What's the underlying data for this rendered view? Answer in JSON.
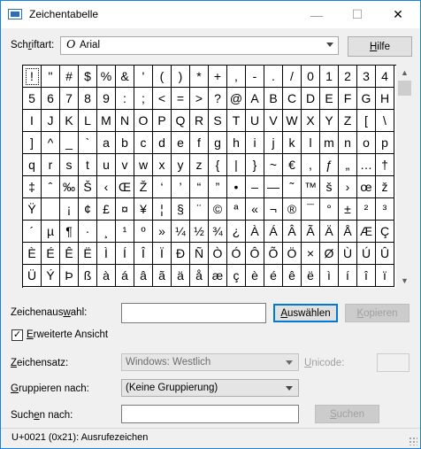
{
  "window": {
    "title": "Zeichentabelle",
    "minimize_glyph": "—",
    "maximize_glyph": "☐",
    "close_glyph": "✕"
  },
  "font_row": {
    "label_pre": "Sch",
    "label_acc": "r",
    "label_post": "iftart:",
    "font_icon": "O",
    "font_value": "Arial",
    "help_pre": "",
    "help_acc": "H",
    "help_post": "ilfe"
  },
  "grid": {
    "columns": 20,
    "selected_index": 0,
    "chars": [
      "!",
      "\"",
      "#",
      "$",
      "%",
      "&",
      "'",
      "(",
      ")",
      "*",
      "+",
      ",",
      "-",
      ".",
      "/",
      "0",
      "1",
      "2",
      "3",
      "4",
      "5",
      "6",
      "7",
      "8",
      "9",
      ":",
      ";",
      "<",
      "=",
      ">",
      "?",
      "@",
      "A",
      "B",
      "C",
      "D",
      "E",
      "F",
      "G",
      "H",
      "I",
      "J",
      "K",
      "L",
      "M",
      "N",
      "O",
      "P",
      "Q",
      "R",
      "S",
      "T",
      "U",
      "V",
      "W",
      "X",
      "Y",
      "Z",
      "[",
      "\\",
      "]",
      "^",
      "_",
      "`",
      "a",
      "b",
      "c",
      "d",
      "e",
      "f",
      "g",
      "h",
      "i",
      "j",
      "k",
      "l",
      "m",
      "n",
      "o",
      "p",
      "q",
      "r",
      "s",
      "t",
      "u",
      "v",
      "w",
      "x",
      "y",
      "z",
      "{",
      "|",
      "}",
      "~",
      "€",
      ",",
      "ƒ",
      "„",
      "…",
      "†",
      "‡",
      "ˆ",
      "‰",
      "Š",
      "‹",
      "Œ",
      "Ž",
      "‘",
      "’",
      "“",
      "”",
      "•",
      "–",
      "—",
      "˜",
      "™",
      "š",
      "›",
      "œ",
      "ž",
      "Ÿ",
      " ",
      "¡",
      "¢",
      "£",
      "¤",
      "¥",
      "¦",
      "§",
      "¨",
      "©",
      "ª",
      "«",
      "¬",
      "®",
      "¯",
      "°",
      "±",
      "²",
      "³",
      "´",
      "µ",
      "¶",
      "·",
      "¸",
      "¹",
      "º",
      "»",
      "¼",
      "½",
      "¾",
      "¿",
      "À",
      "Á",
      "Â",
      "Ã",
      "Ä",
      "Å",
      "Æ",
      "Ç",
      "È",
      "É",
      "Ê",
      "Ë",
      "Ì",
      "Í",
      "Î",
      "Ï",
      "Ð",
      "Ñ",
      "Ò",
      "Ó",
      "Ô",
      "Õ",
      "Ö",
      "×",
      "Ø",
      "Ù",
      "Ú",
      "Û",
      "Ü",
      "Ý",
      "Þ",
      "ß",
      "à",
      "á",
      "â",
      "ã",
      "ä",
      "å",
      "æ",
      "ç",
      "è",
      "é",
      "ê",
      "ë",
      "ì",
      "í",
      "î",
      "ï"
    ]
  },
  "scrollbar": {
    "up_glyph": "▲",
    "down_glyph": "▼"
  },
  "selection_row": {
    "label_pre": "Zeichenaus",
    "label_acc": "w",
    "label_post": "ahl:",
    "value": "",
    "select_pre": "",
    "select_acc": "A",
    "select_post": "uswählen",
    "copy_pre": "",
    "copy_acc": "K",
    "copy_post": "opieren"
  },
  "advanced": {
    "checked_glyph": "✓",
    "label_pre": "",
    "label_acc": "E",
    "label_post": "rweiterte Ansicht"
  },
  "charset_row": {
    "label_pre": "",
    "label_acc": "Z",
    "label_post": "eichensatz:",
    "value": "Windows: Westlich",
    "unicode_pre": "",
    "unicode_acc": "U",
    "unicode_post": "nicode:",
    "unicode_value": ""
  },
  "group_row": {
    "label_pre": "",
    "label_acc": "G",
    "label_post": "ruppieren nach:",
    "value": "(Keine Gruppierung)"
  },
  "search_row": {
    "label_pre": "Such",
    "label_acc": "e",
    "label_post": "n nach:",
    "value": "",
    "button_pre": "",
    "button_acc": "S",
    "button_post": "uchen"
  },
  "status": {
    "text": "U+0021 (0x21): Ausrufezeichen"
  }
}
